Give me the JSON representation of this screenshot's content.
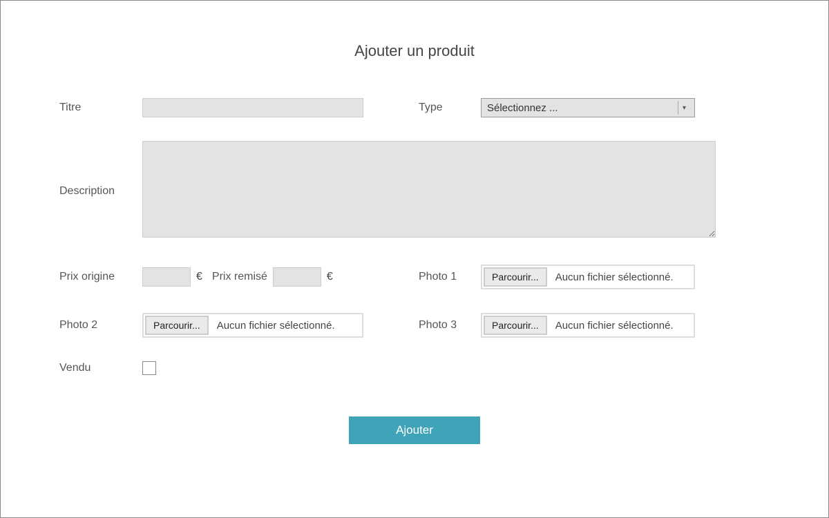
{
  "title": "Ajouter un produit",
  "labels": {
    "titre": "Titre",
    "type": "Type",
    "description": "Description",
    "prix_origine": "Prix origine",
    "prix_remise": "Prix remisé",
    "photo1": "Photo 1",
    "photo2": "Photo 2",
    "photo3": "Photo 3",
    "vendu": "Vendu"
  },
  "type_select": {
    "placeholder": "Sélectionnez ..."
  },
  "currency": "€",
  "file": {
    "browse": "Parcourir...",
    "none": "Aucun fichier sélectionné."
  },
  "submit": "Ajouter"
}
